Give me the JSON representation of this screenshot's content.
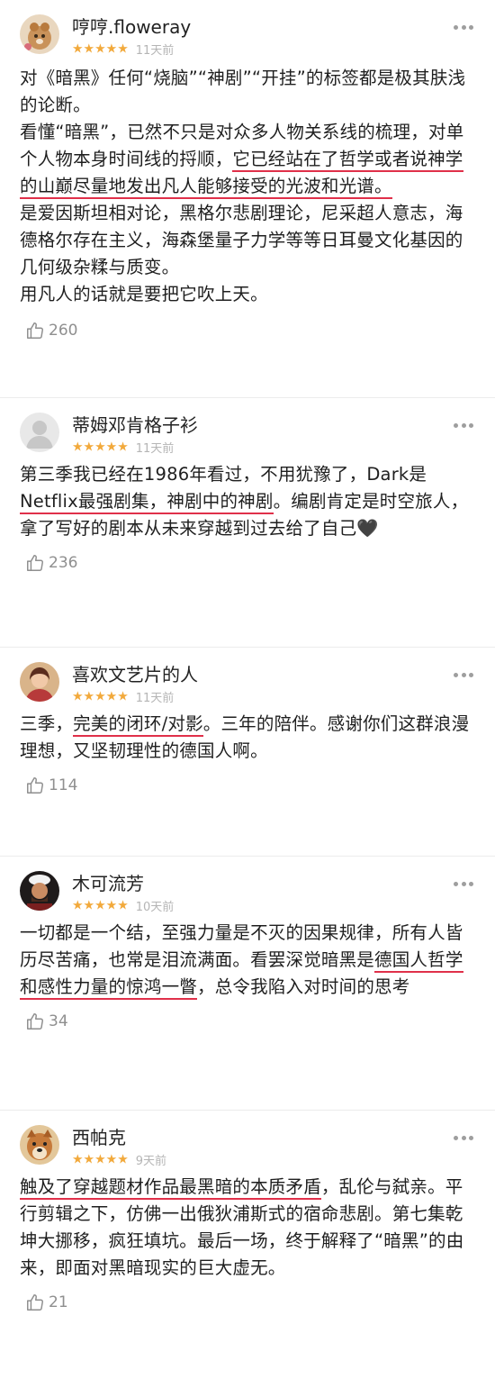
{
  "reviews": [
    {
      "user": "哼哼.floweray",
      "stars": "★★★★★",
      "time": "11天前",
      "paragraphs": [
        {
          "parts": [
            {
              "t": "对《暗黑》任何“烧脑”“神剧”“开挂”的标签都是极其肤浅的论断。"
            }
          ]
        },
        {
          "parts": [
            {
              "t": "看懂“暗黑”，已然不只是对众多人物关系线的梳理，对单个人物本身时间线的捋顺，"
            },
            {
              "t": "它已经站在了哲学或者说神学的山巅尽量地发出凡人能够接受的光波和光谱。",
              "hl": true
            }
          ]
        },
        {
          "parts": [
            {
              "t": "是爱因斯坦相对论，黑格尔悲剧理论，尼采超人意志，海德格尔存在主义，海森堡量子力学等等日耳曼文化基因的几何级杂糅与质变。"
            }
          ]
        },
        {
          "parts": [
            {
              "t": "用凡人的话就是要把它吹上天。"
            }
          ]
        }
      ],
      "likes": "260"
    },
    {
      "user": "蒂姆邓肯格子衫",
      "stars": "★★★★★",
      "time": "11天前",
      "paragraphs": [
        {
          "parts": [
            {
              "t": "第三季我已经在1986年看过，不用犹豫了，Dark是"
            },
            {
              "t": "Netflix最强剧集，神剧中的神剧",
              "hl": true
            },
            {
              "t": "。编剧肯定是时空旅人，拿了写好的剧本从未来穿越到过去给了自己🖤"
            }
          ]
        }
      ],
      "likes": "236"
    },
    {
      "user": "喜欢文艺片的人",
      "stars": "★★★★★",
      "time": "11天前",
      "paragraphs": [
        {
          "parts": [
            {
              "t": "三季，"
            },
            {
              "t": "完美的闭环/对影",
              "hl": true
            },
            {
              "t": "。三年的陪伴。感谢你们这群浪漫理想，又坚韧理性的德国人啊。"
            }
          ]
        }
      ],
      "likes": "114"
    },
    {
      "user": "木可流芳",
      "stars": "★★★★★",
      "time": "10天前",
      "paragraphs": [
        {
          "parts": [
            {
              "t": "一切都是一个结，至强力量是不灭的因果规律，所有人皆历尽苦痛，也常是泪流满面。看罢深觉暗黑是"
            },
            {
              "t": "德国人哲学和感性力量的惊鸿一瞥",
              "hl": true
            },
            {
              "t": "，总令我陷入对时间的思考"
            }
          ]
        }
      ],
      "likes": "34"
    },
    {
      "user": "西帕克",
      "stars": "★★★★★",
      "time": "9天前",
      "paragraphs": [
        {
          "parts": [
            {
              "t": "触及了穿越题材作品最黑暗的本质矛盾",
              "hl": true
            },
            {
              "t": "，乱伦与弑亲。平行剪辑之下，仿佛一出俄狄浦斯式的宿命悲剧。第七集乾坤大挪移，疯狂填坑。最后一场，终于解释了“暗黑”的由来，即面对黑暗现实的巨大虚无。"
            }
          ]
        }
      ],
      "likes": "21"
    }
  ]
}
